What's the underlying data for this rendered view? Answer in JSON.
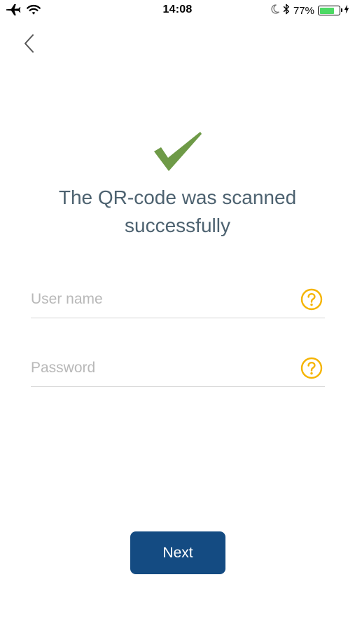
{
  "status_bar": {
    "time": "14:08",
    "battery_percent": "77%",
    "battery_level": 0.77,
    "left_icons": [
      "airplane-icon",
      "wifi-icon"
    ],
    "right_icons": [
      "moon-icon",
      "bluetooth-icon",
      "battery-icon",
      "charging-bolt-icon"
    ],
    "battery_color": "#4cd964"
  },
  "nav": {
    "back_icon": "chevron-left-icon"
  },
  "success": {
    "icon": "checkmark-icon",
    "icon_color": "#6e9a47",
    "title_line1": "The QR-code was scanned",
    "title_line2": "successfully"
  },
  "form": {
    "username": {
      "placeholder": "User name",
      "value": "",
      "help_icon": "question-circle-icon"
    },
    "password": {
      "placeholder": "Password",
      "value": "",
      "help_icon": "question-circle-icon"
    },
    "help_icon_color": "#f5b400"
  },
  "actions": {
    "next_label": "Next",
    "next_color": "#144b82"
  }
}
